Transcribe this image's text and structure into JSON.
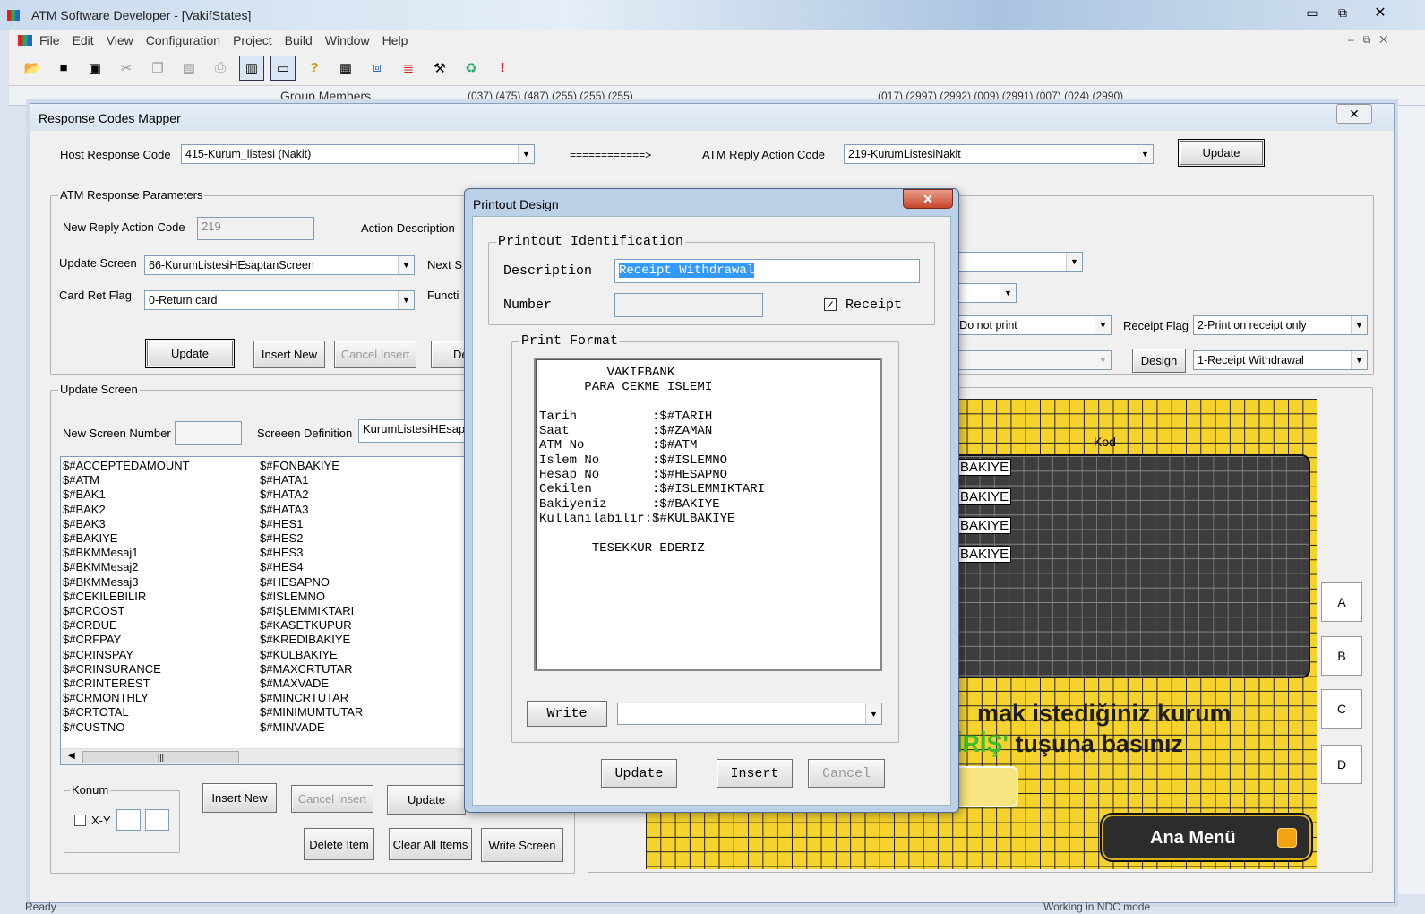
{
  "app": {
    "title": "ATM Software Developer - [VakifStates]",
    "menus": [
      "File",
      "Edit",
      "View",
      "Configuration",
      "Project",
      "Build",
      "Window",
      "Help"
    ],
    "status": "Ready",
    "status_right": "Working in NDC mode"
  },
  "bg": {
    "group_members": "Group Members",
    "codes_strip": "(037) (475) (487) (255) (255) (255)",
    "codes_strip2": "(017) (2997) (2992) (009) (2991) (007) (024) (2990)"
  },
  "mapper": {
    "title": "Response Codes Mapper",
    "host_label": "Host Response Code",
    "host_value": "415-Kurum_listesi (Nakit)",
    "arrow": "============>",
    "reply_label": "ATM Reply Action Code",
    "reply_value": "219-KurumListesiNakit",
    "update_top": "Update",
    "params_title": "ATM Response Parameters",
    "new_reply_label": "New Reply Action Code",
    "new_reply_value": "219",
    "action_desc_label": "Action Description",
    "update_screen_label": "Update Screen",
    "update_screen_value": "66-KurumListesiHEsaptanScreen",
    "next_label": "Next S",
    "card_ret_label": "Card Ret Flag",
    "card_ret_value": "0-Return card",
    "function_label": "Functi",
    "btn_update": "Update",
    "btn_insert_new": "Insert New",
    "btn_cancel_insert": "Cancel Insert",
    "btn_de": "De",
    "print_value": "-Do not print",
    "receipt_flag_label": "Receipt Flag",
    "receipt_flag_value": "2-Print on receipt only",
    "design_btn": "Design",
    "design_value": "1-Receipt Withdrawal",
    "us_title": "Update Screen",
    "new_screen_label": "New Screen Number",
    "screen_def_label": "Screeen Definition",
    "screen_def_value": "KurumListesiHEsapt",
    "list_col1": [
      "$#ACCEPTEDAMOUNT",
      "$#ATM",
      "$#BAK1",
      "$#BAK2",
      "$#BAK3",
      "$#BAKIYE",
      "$#BKMMesaj1",
      "$#BKMMesaj2",
      "$#BKMMesaj3",
      "$#CEKILEBILIR",
      "$#CRCOST",
      "$#CRDUE",
      "$#CRFPAY",
      "$#CRINSPAY",
      "$#CRINSURANCE",
      "$#CRINTEREST",
      "$#CRMONTHLY",
      "$#CRTOTAL",
      "$#CUSTNO"
    ],
    "list_col2": [
      "$#FONBAKIYE",
      "$#HATA1",
      "$#HATA2",
      "$#HATA3",
      "$#HES1",
      "$#HES2",
      "$#HES3",
      "$#HES4",
      "$#HESAPNO",
      "$#ISLEMNO",
      "$#IŞLEMMIKTARI",
      "$#KASETKUPUR",
      "$#KREDIBAKIYE",
      "$#KULBAKIYE",
      "$#MAXCRTUTAR",
      "$#MAXVADE",
      "$#MINCRTUTAR",
      "$#MINIMUMTUTAR",
      "$#MINVADE"
    ],
    "konum_title": "Konum",
    "xy_label": "X-Y",
    "btn_insert_new2": "Insert New",
    "btn_cancel_insert2": "Cancel Insert",
    "btn_update2": "Update",
    "btn_delete": "Delete Item",
    "btn_clear": "Clear All Items",
    "btn_write_screen": "Write Screen"
  },
  "preview": {
    "kod": "Kod",
    "bakiye": [
      "BAKIYE",
      "BAKIYE",
      "BAKIYE",
      "BAKIYE"
    ],
    "line1": "mak istediğiniz kurum",
    "line2_green": "İRİŞ'",
    "line2": " tuşuna basınız",
    "ana_menu": "Ana Menü",
    "side_buttons": [
      "A",
      "B",
      "C",
      "D"
    ]
  },
  "printout": {
    "title": "Printout Design",
    "ident_title": "Printout Identification",
    "desc_label": "Description",
    "desc_value": "Receipt Withdrawal",
    "number_label": "Number",
    "receipt_label": "Receipt",
    "receipt_checked": "✓",
    "format_title": "Print Format",
    "format_lines": [
      "         VAKIFBANK",
      "      PARA CEKME ISLEMI",
      "",
      "Tarih          :$#TARIH",
      "Saat           :$#ZAMAN",
      "ATM No         :$#ATM",
      "Islem No       :$#ISLEMNO",
      "Hesap No       :$#HESAPNO",
      "Cekilen        :$#ISLEMMIKTARI",
      "Bakiyeniz      :$#BAKIYE",
      "Kullanilabilir:$#KULBAKIYE",
      "",
      "       TESEKKUR EDERIZ"
    ],
    "write_btn": "Write",
    "update_btn": "Update",
    "insert_btn": "Insert",
    "cancel_btn": "Cancel"
  }
}
